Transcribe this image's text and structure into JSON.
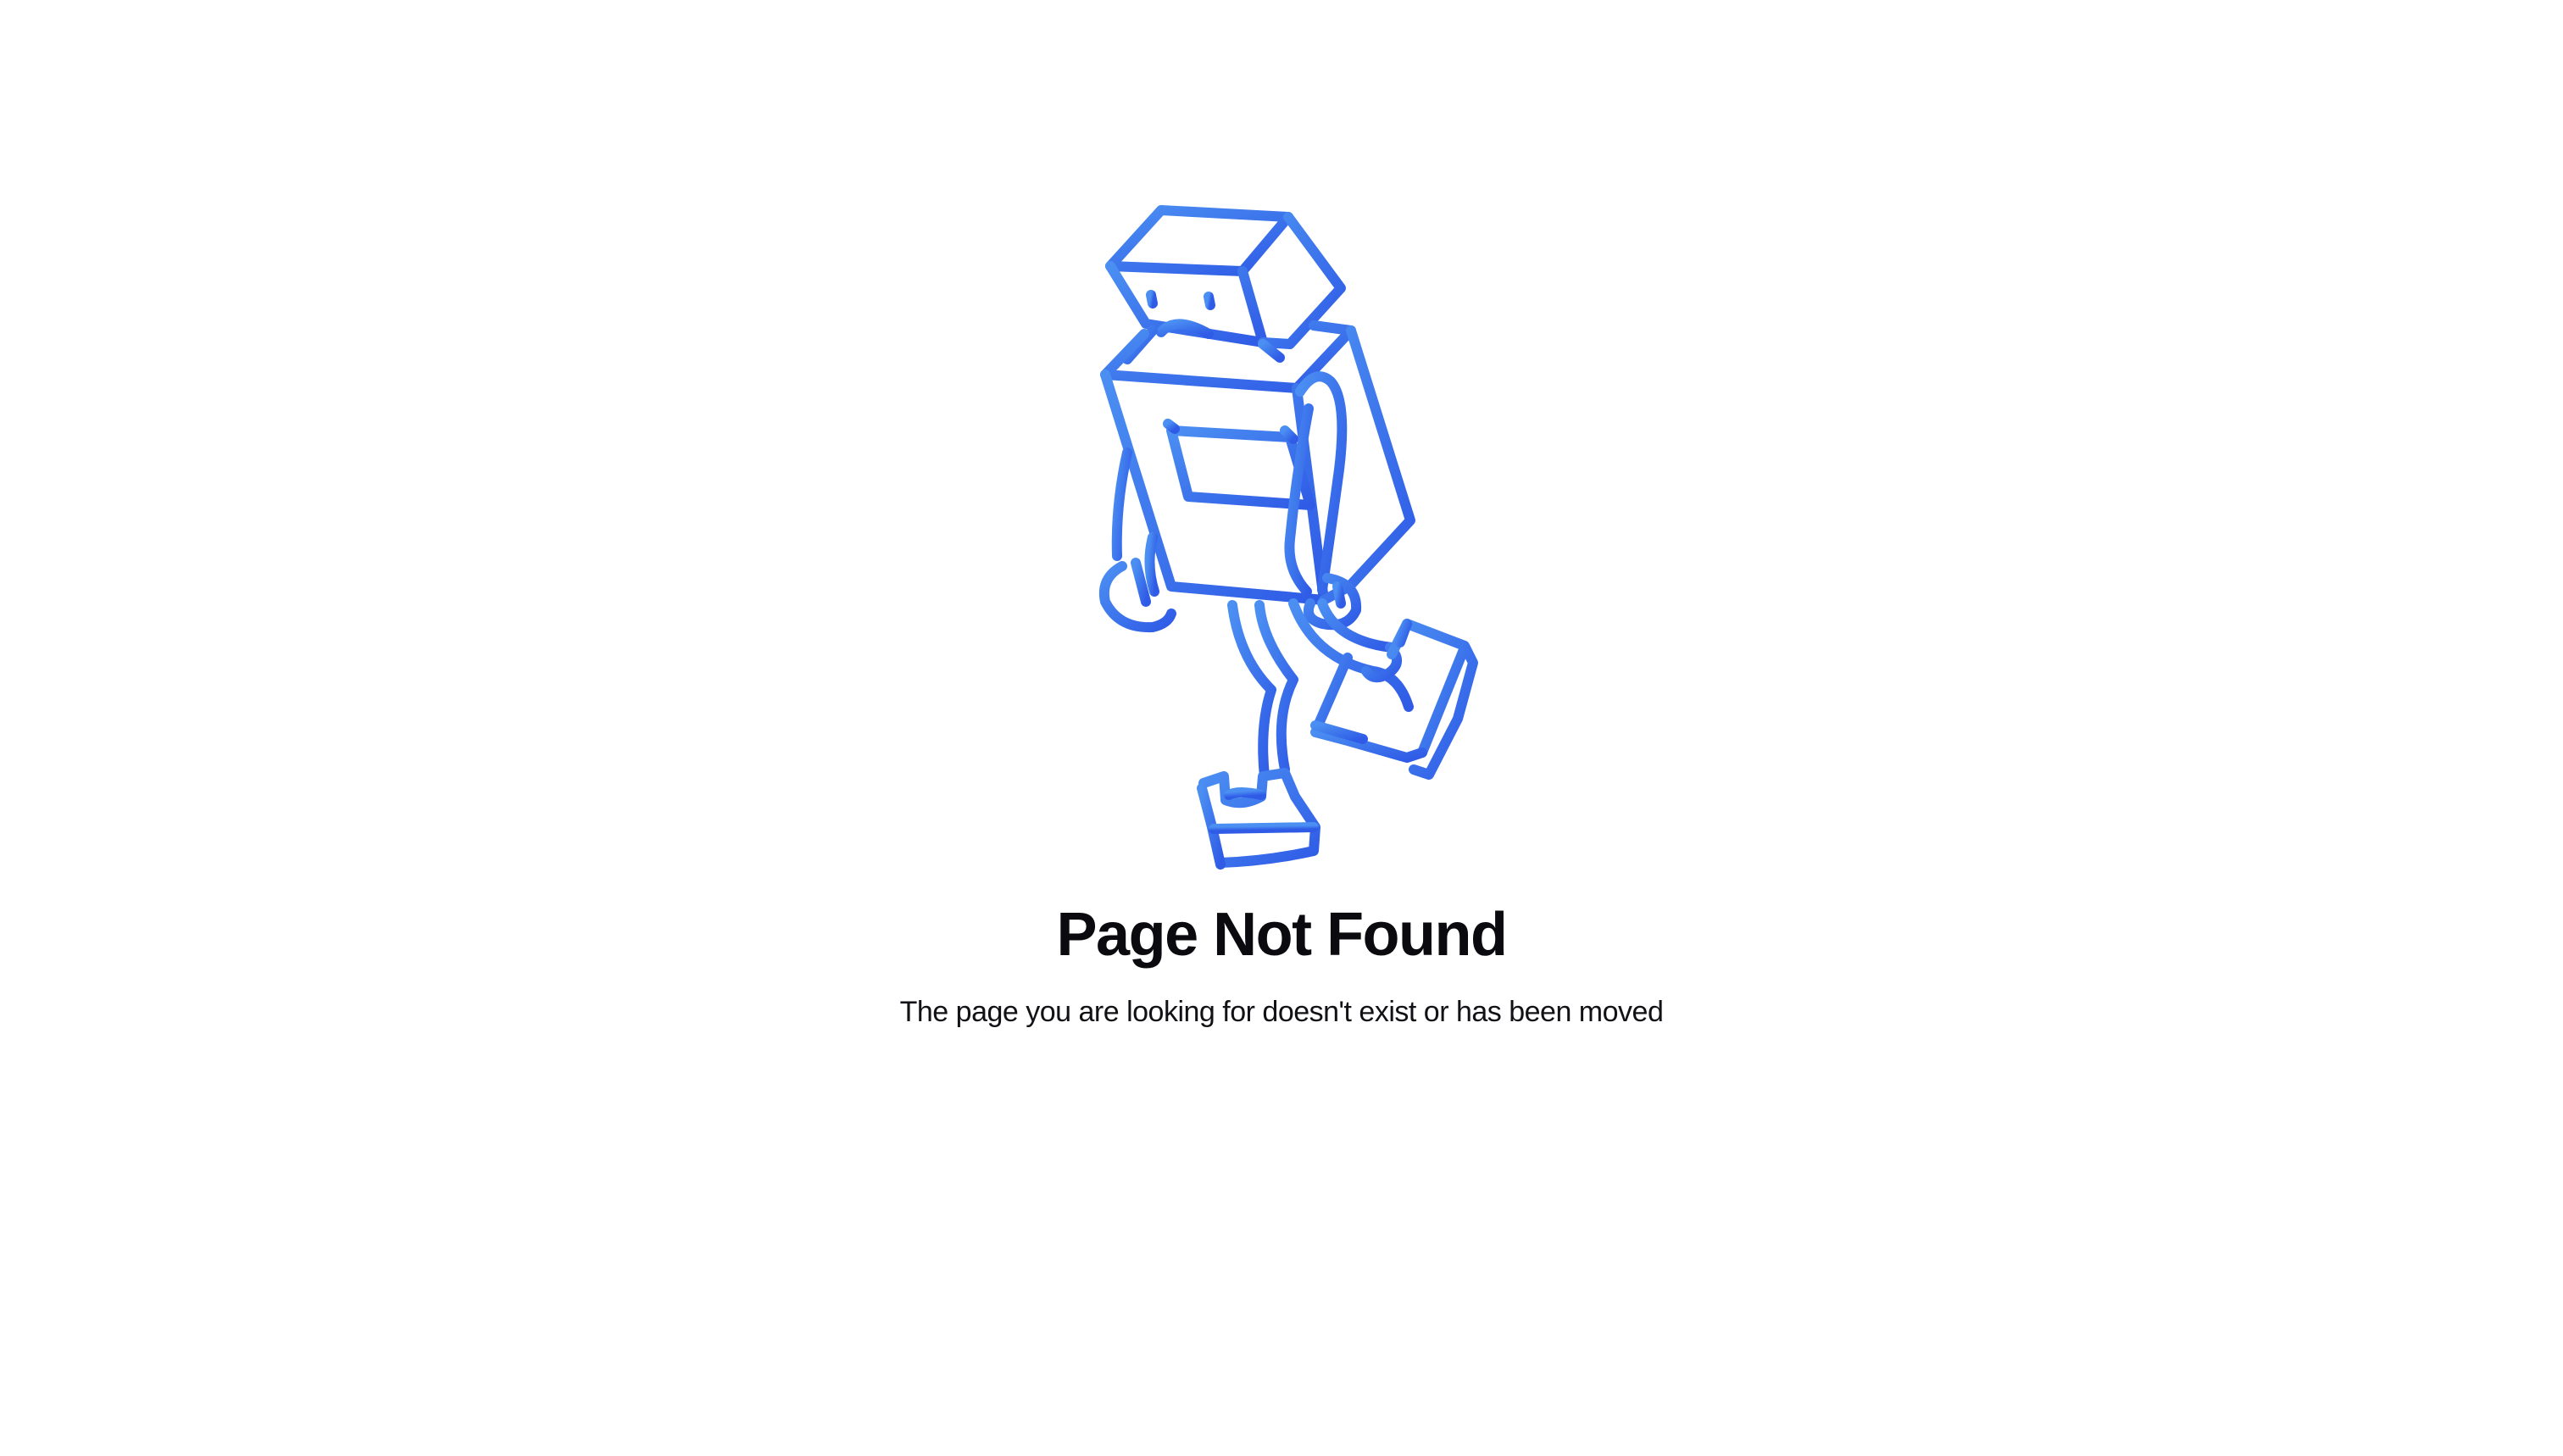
{
  "not_found": {
    "illustration_icon": "sad-robot-walking-icon",
    "title": "Page Not Found",
    "message": "The page you are looking for doesn't exist or has been moved"
  },
  "colors": {
    "background": "#ffffff",
    "illustration_gradient_start": "#4b8ff2",
    "illustration_gradient_end": "#2f5be6",
    "title_text": "#0b0b0f",
    "message_text": "#111116"
  }
}
